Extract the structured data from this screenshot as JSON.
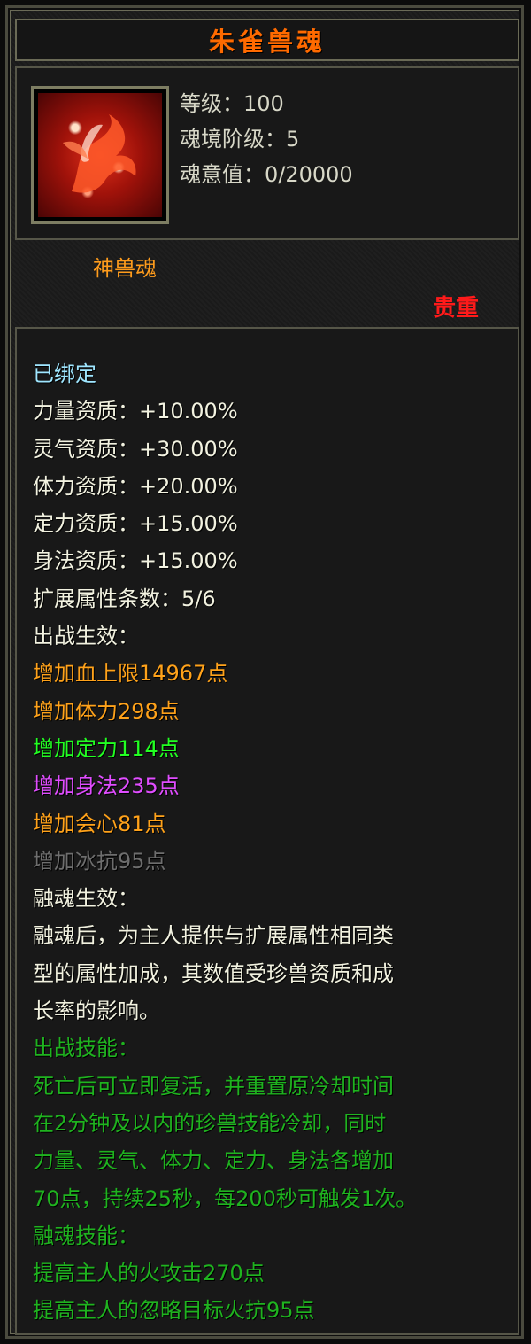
{
  "title": "朱雀兽魂",
  "icon": "vermilion-bird-icon",
  "stats": [
    "等级：100",
    "魂境阶级：5",
    "魂意值：0/20000"
  ],
  "type_label": "神兽魂",
  "rarity_label": "贵重",
  "lines": [
    {
      "text": "已绑定",
      "color": "bound"
    },
    {
      "text": "力量资质：+10.00%",
      "color": "white"
    },
    {
      "text": "灵气资质：+30.00%",
      "color": "white"
    },
    {
      "text": "体力资质：+20.00%",
      "color": "white"
    },
    {
      "text": "定力资质：+15.00%",
      "color": "white"
    },
    {
      "text": "身法资质：+15.00%",
      "color": "white"
    },
    {
      "text": "扩展属性条数：5/6",
      "color": "white"
    },
    {
      "text": "出战生效：",
      "color": "white"
    },
    {
      "text": "增加血上限14967点",
      "color": "orange"
    },
    {
      "text": "增加体力298点",
      "color": "orange"
    },
    {
      "text": "增加定力114点",
      "color": "green"
    },
    {
      "text": "增加身法235点",
      "color": "purple"
    },
    {
      "text": "增加会心81点",
      "color": "orange"
    },
    {
      "text": "增加冰抗95点",
      "color": "gray"
    },
    {
      "text": "融魂生效：",
      "color": "white"
    },
    {
      "text": "融魂后，为主人提供与扩展属性相同类",
      "color": "white"
    },
    {
      "text": "型的属性加成，其数值受珍兽资质和成",
      "color": "white"
    },
    {
      "text": "长率的影响。",
      "color": "white"
    },
    {
      "text": "出战技能：",
      "color": "darkgreen"
    },
    {
      "text": "死亡后可立即复活，并重置原冷却时间",
      "color": "darkgreen"
    },
    {
      "text": "在2分钟及以内的珍兽技能冷却，同时",
      "color": "darkgreen"
    },
    {
      "text": "力量、灵气、体力、定力、身法各增加",
      "color": "darkgreen"
    },
    {
      "text": "70点，持续25秒，每200秒可触发1次。",
      "color": "darkgreen"
    },
    {
      "text": "融魂技能：",
      "color": "darkgreen"
    },
    {
      "text": "提高主人的火攻击270点",
      "color": "darkgreen"
    },
    {
      "text": "提高主人的忽略目标火抗95点",
      "color": "darkgreen"
    }
  ],
  "colors": {
    "title": "#ff6a00",
    "orange": "#ffa21a",
    "green": "#22ff22",
    "purple": "#e04dff",
    "gray": "#6e6e6e",
    "darkgreen": "#1fb31f",
    "rarity": "#ff1a1a"
  }
}
